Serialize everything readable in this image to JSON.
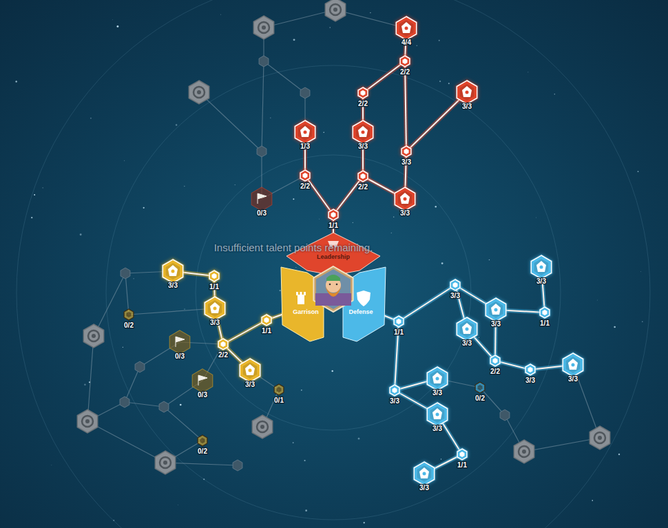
{
  "message": "Insufficient talent points remaining.",
  "branches": [
    {
      "name": "Leadership",
      "color": "#e0452c",
      "nodes": [
        {
          "level": "1/1",
          "state": "learned",
          "kind": "minor"
        },
        {
          "level": "2/2",
          "state": "learned",
          "kind": "minor"
        },
        {
          "level": "1/3",
          "state": "learned",
          "kind": "major"
        },
        {
          "level": "2/2",
          "state": "learned",
          "kind": "minor"
        },
        {
          "level": "3/3",
          "state": "learned",
          "kind": "major"
        },
        {
          "level": "2/2",
          "state": "learned",
          "kind": "minor"
        },
        {
          "level": "3/3",
          "state": "learned",
          "kind": "major"
        },
        {
          "level": "3/3",
          "state": "learned",
          "kind": "minor"
        },
        {
          "level": "3/3",
          "state": "learned",
          "kind": "major"
        },
        {
          "level": "2/2",
          "state": "learned",
          "kind": "minor"
        },
        {
          "level": "4/4",
          "state": "learned",
          "kind": "major"
        },
        {
          "level": "0/3",
          "state": "available",
          "kind": "major"
        },
        {
          "level": "",
          "state": "locked",
          "kind": "minor"
        },
        {
          "level": "",
          "state": "locked",
          "kind": "minor"
        },
        {
          "level": "",
          "state": "locked",
          "kind": "minor"
        },
        {
          "level": "",
          "state": "locked",
          "kind": "major"
        },
        {
          "level": "",
          "state": "locked",
          "kind": "major"
        },
        {
          "level": "",
          "state": "locked",
          "kind": "major"
        }
      ]
    },
    {
      "name": "Garrison",
      "color": "#e9b62b",
      "nodes": [
        {
          "level": "1/1",
          "state": "learned",
          "kind": "minor"
        },
        {
          "level": "2/2",
          "state": "learned",
          "kind": "minor"
        },
        {
          "level": "3/3",
          "state": "learned",
          "kind": "major"
        },
        {
          "level": "1/1",
          "state": "learned",
          "kind": "minor"
        },
        {
          "level": "3/3",
          "state": "learned",
          "kind": "major"
        },
        {
          "level": "3/3",
          "state": "learned",
          "kind": "major"
        },
        {
          "level": "0/3",
          "state": "available",
          "kind": "major"
        },
        {
          "level": "0/3",
          "state": "available",
          "kind": "major"
        },
        {
          "level": "0/1",
          "state": "available",
          "kind": "minor"
        },
        {
          "level": "0/2",
          "state": "available",
          "kind": "minor"
        },
        {
          "level": "0/2",
          "state": "available",
          "kind": "minor"
        },
        {
          "level": "",
          "state": "locked",
          "kind": "minor"
        },
        {
          "level": "",
          "state": "locked",
          "kind": "major"
        },
        {
          "level": "",
          "state": "locked",
          "kind": "minor"
        },
        {
          "level": "",
          "state": "locked",
          "kind": "minor"
        },
        {
          "level": "",
          "state": "locked",
          "kind": "minor"
        },
        {
          "level": "",
          "state": "locked",
          "kind": "major"
        },
        {
          "level": "",
          "state": "locked",
          "kind": "major"
        },
        {
          "level": "",
          "state": "locked",
          "kind": "minor"
        },
        {
          "level": "",
          "state": "locked",
          "kind": "major"
        }
      ]
    },
    {
      "name": "Defense",
      "color": "#4cb9e8",
      "nodes": [
        {
          "level": "1/1",
          "state": "learned",
          "kind": "minor"
        },
        {
          "level": "3/3",
          "state": "learned",
          "kind": "minor"
        },
        {
          "level": "3/3",
          "state": "learned",
          "kind": "major"
        },
        {
          "level": "3/3",
          "state": "learned",
          "kind": "major"
        },
        {
          "level": "1/1",
          "state": "learned",
          "kind": "minor"
        },
        {
          "level": "3/3",
          "state": "learned",
          "kind": "major"
        },
        {
          "level": "2/2",
          "state": "learned",
          "kind": "minor"
        },
        {
          "level": "3/3",
          "state": "learned",
          "kind": "minor"
        },
        {
          "level": "3/3",
          "state": "learned",
          "kind": "major"
        },
        {
          "level": "3/3",
          "state": "learned",
          "kind": "minor"
        },
        {
          "level": "3/3",
          "state": "learned",
          "kind": "major"
        },
        {
          "level": "3/3",
          "state": "learned",
          "kind": "major"
        },
        {
          "level": "0/2",
          "state": "available",
          "kind": "minor"
        },
        {
          "level": "1/1",
          "state": "learned",
          "kind": "minor"
        },
        {
          "level": "3/3",
          "state": "learned",
          "kind": "major"
        },
        {
          "level": "",
          "state": "locked",
          "kind": "minor"
        },
        {
          "level": "",
          "state": "locked",
          "kind": "major"
        },
        {
          "level": "",
          "state": "locked",
          "kind": "major"
        }
      ]
    }
  ]
}
